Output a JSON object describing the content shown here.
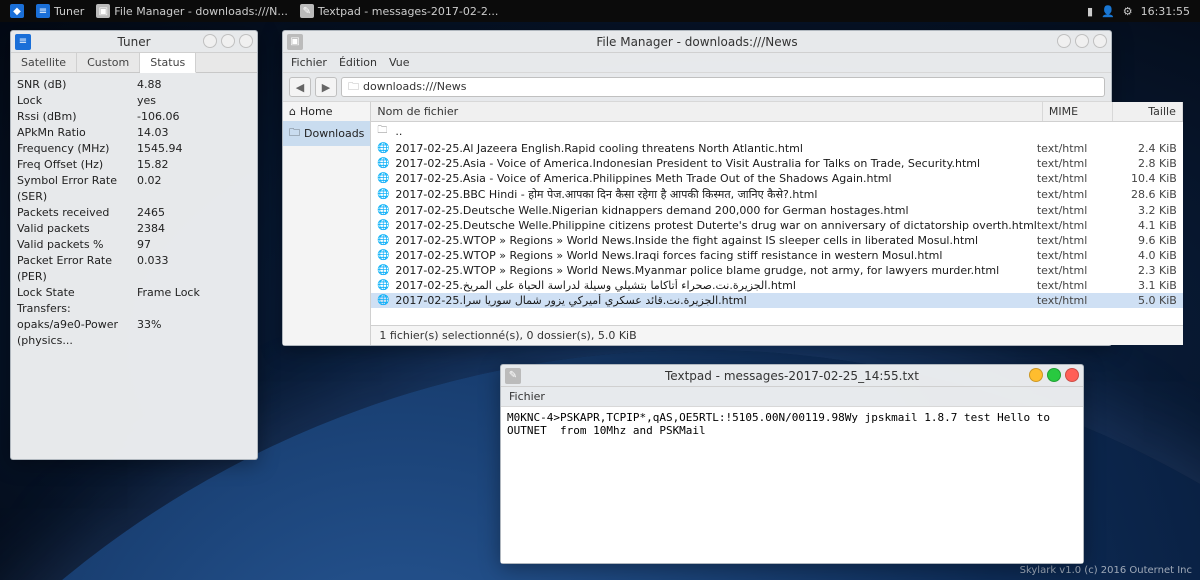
{
  "taskbar": {
    "items": [
      {
        "label": "Tuner"
      },
      {
        "label": "File Manager - downloads:///N..."
      },
      {
        "label": "Textpad - messages-2017-02-2..."
      }
    ],
    "clock": "16:31:55"
  },
  "tuner": {
    "title": "Tuner",
    "tabs": [
      "Satellite",
      "Custom",
      "Status"
    ],
    "active_tab": 2,
    "rows": [
      {
        "k": "SNR (dB)",
        "v": "4.88"
      },
      {
        "k": "Lock",
        "v": "yes"
      },
      {
        "k": "Rssi (dBm)",
        "v": "-106.06"
      },
      {
        "k": "APkMn Ratio",
        "v": "14.03"
      },
      {
        "k": "Frequency (MHz)",
        "v": "1545.94"
      },
      {
        "k": "Freq Offset (Hz)",
        "v": "15.82"
      },
      {
        "k": "Symbol Error Rate (SER)",
        "v": "0.02"
      },
      {
        "k": "Packets received",
        "v": "2465"
      },
      {
        "k": "Valid packets",
        "v": "2384"
      },
      {
        "k": "Valid packets %",
        "v": "97"
      },
      {
        "k": "Packet Error Rate (PER)",
        "v": "0.033"
      },
      {
        "k": "Lock State",
        "v": "Frame Lock"
      },
      {
        "k": "Transfers:",
        "v": ""
      },
      {
        "k": "opaks/a9e0-Power (physics...",
        "v": "33%"
      }
    ]
  },
  "fm": {
    "title": "File Manager - downloads:///News",
    "menu": [
      "Fichier",
      "Édition",
      "Vue"
    ],
    "address": "downloads:///News",
    "side": {
      "home": "Home",
      "downloads": "Downloads"
    },
    "columns": {
      "name": "Nom de fichier",
      "mime": "MIME",
      "size": "Taille"
    },
    "parent_label": "..",
    "files": [
      {
        "name": "2017-02-25.Al Jazeera English.Rapid cooling threatens North Atlantic.html",
        "mime": "text/html",
        "size": "2.4 KiB"
      },
      {
        "name": "2017-02-25.Asia - Voice of America.Indonesian President to Visit Australia for Talks on Trade, Security.html",
        "mime": "text/html",
        "size": "2.8 KiB"
      },
      {
        "name": "2017-02-25.Asia - Voice of America.Philippines Meth Trade Out of the Shadows Again.html",
        "mime": "text/html",
        "size": "10.4 KiB"
      },
      {
        "name": "2017-02-25.BBC Hindi - होम पेज.आपका दिन कैसा रहेगा है आपकी किस्मत, जानिए कैसे?.html",
        "mime": "text/html",
        "size": "28.6 KiB"
      },
      {
        "name": "2017-02-25.Deutsche Welle.Nigerian kidnappers demand 200,000 for German hostages.html",
        "mime": "text/html",
        "size": "3.2 KiB"
      },
      {
        "name": "2017-02-25.Deutsche Welle.Philippine citizens protest Duterte's drug war on anniversary of dictatorship overth.html",
        "mime": "text/html",
        "size": "4.1 KiB"
      },
      {
        "name": "2017-02-25.WTOP » Regions » World News.Inside the fight against IS sleeper cells in liberated Mosul.html",
        "mime": "text/html",
        "size": "9.6 KiB"
      },
      {
        "name": "2017-02-25.WTOP » Regions » World News.Iraqi forces facing stiff resistance in western Mosul.html",
        "mime": "text/html",
        "size": "4.0 KiB"
      },
      {
        "name": "2017-02-25.WTOP » Regions » World News.Myanmar police blame grudge, not army, for lawyers murder.html",
        "mime": "text/html",
        "size": "2.3 KiB"
      },
      {
        "name": "2017-02-25.الجزيرة.نت.صحراء أتاكاما بتشيلي وسيلة لدراسة الحياة على المريخ.html",
        "mime": "text/html",
        "size": "3.1 KiB"
      },
      {
        "name": "2017-02-25.الجزيرة.نت.قائد عسكري أميركي يزور شمال سوريا سرا.html",
        "mime": "text/html",
        "size": "5.0 KiB",
        "selected": true
      }
    ],
    "status": "1 fichier(s) selectionné(s), 0 dossier(s), 5.0 KiB"
  },
  "textpad": {
    "title": "Textpad - messages-2017-02-25_14:55.txt",
    "menu": [
      "Fichier"
    ],
    "content": "M0KNC-4>PSKAPR,TCPIP*,qAS,OE5RTL:!5105.00N/00119.98Wy jpskmail 1.8.7 test Hello to OUTNET  from 10Mhz and PSKMail"
  },
  "credit": "Skylark v1.0 (c) 2016 Outernet Inc"
}
